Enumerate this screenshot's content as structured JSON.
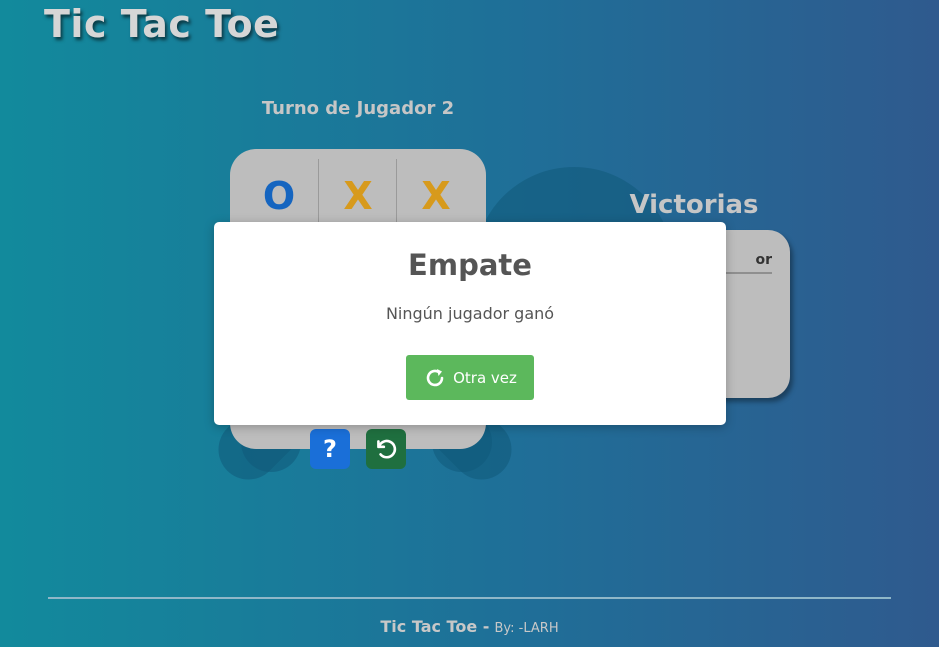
{
  "app": {
    "title": "Tic Tac Toe"
  },
  "game": {
    "turn_label": "Turno de Jugador 2",
    "board_top_row": [
      {
        "mark": "O",
        "color": "#1565c0"
      },
      {
        "mark": "X",
        "color": "#d79a1c"
      },
      {
        "mark": "X",
        "color": "#d79a1c"
      }
    ],
    "help_label": "?",
    "reset_icon": "undo-icon"
  },
  "wins": {
    "title": "Victorias",
    "header_visible": "or"
  },
  "modal": {
    "title": "Empate",
    "message": "Ningún jugador ganó",
    "button_label": "Otra vez",
    "button_icon": "refresh-icon",
    "button_color": "#5cb85c"
  },
  "footer": {
    "title": "Tic Tac Toe -",
    "byline": "By: -LARH"
  },
  "colors": {
    "help_button": "#1a6fd8",
    "reset_button": "#1f6f3f"
  }
}
